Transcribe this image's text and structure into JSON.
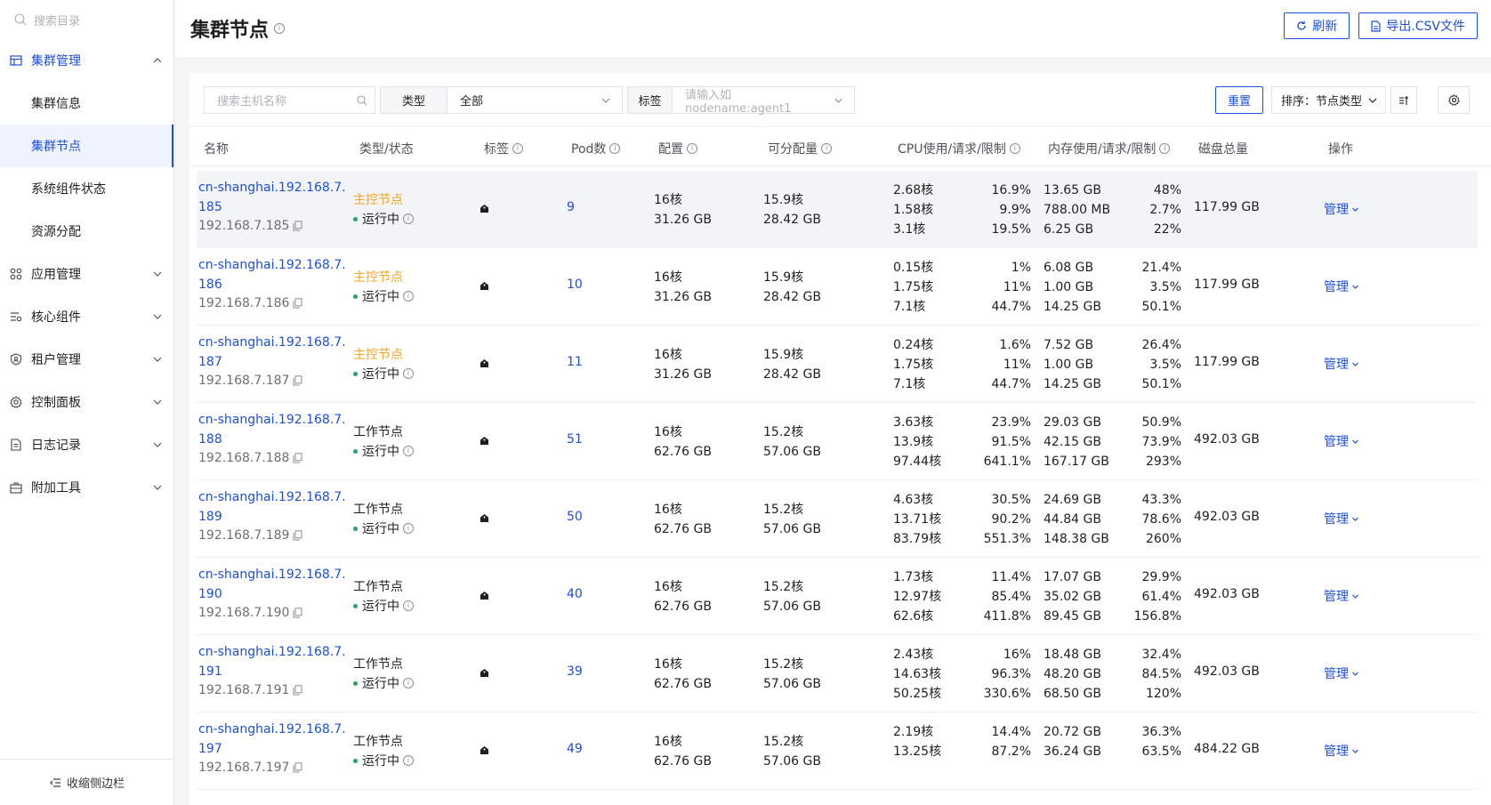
{
  "sidebar": {
    "search_placeholder": "搜索目录",
    "groups": [
      {
        "label": "集群管理",
        "icon": "cluster-icon",
        "expanded": true
      },
      {
        "label": "应用管理",
        "icon": "apps-icon"
      },
      {
        "label": "核心组件",
        "icon": "components-icon"
      },
      {
        "label": "租户管理",
        "icon": "tenant-icon"
      },
      {
        "label": "控制面板",
        "icon": "gear-icon"
      },
      {
        "label": "日志记录",
        "icon": "log-icon"
      },
      {
        "label": "附加工具",
        "icon": "toolbox-icon"
      }
    ],
    "sub_items": [
      "集群信息",
      "集群节点",
      "系统组件状态",
      "资源分配"
    ],
    "active_sub": "集群节点",
    "collapse_label": "收缩侧边栏"
  },
  "header": {
    "title": "集群节点",
    "refresh_label": "刷新",
    "export_label": "导出.CSV文件"
  },
  "filters": {
    "search_placeholder": "搜索主机名称",
    "type_label": "类型",
    "type_value": "全部",
    "tag_label": "标签",
    "tag_placeholder": "请输入如 nodename:agent1",
    "reset_label": "重置",
    "sort_label": "排序：节点类型"
  },
  "table": {
    "columns": [
      "名称",
      "类型/状态",
      "标签",
      "Pod数",
      "配置",
      "可分配量",
      "CPU使用/请求/限制",
      "内存使用/请求/限制",
      "磁盘总量",
      "操作"
    ],
    "rows": [
      {
        "name": "cn-shanghai.192.168.7.185",
        "ip": "192.168.7.185",
        "type": "主控节点",
        "status": "运行中",
        "pods": "9",
        "cfg_cpu": "16核",
        "cfg_mem": "31.26 GB",
        "alloc_cpu": "15.9核",
        "alloc_mem": "28.42 GB",
        "cpu": [
          [
            "2.68核",
            "16.9%"
          ],
          [
            "1.58核",
            "9.9%"
          ],
          [
            "3.1核",
            "19.5%"
          ]
        ],
        "mem": [
          [
            "13.65 GB",
            "48%"
          ],
          [
            "788.00 MB",
            "2.7%"
          ],
          [
            "6.25 GB",
            "22%"
          ]
        ],
        "disk": "117.99 GB",
        "op": "管理"
      },
      {
        "name": "cn-shanghai.192.168.7.186",
        "ip": "192.168.7.186",
        "type": "主控节点",
        "status": "运行中",
        "pods": "10",
        "cfg_cpu": "16核",
        "cfg_mem": "31.26 GB",
        "alloc_cpu": "15.9核",
        "alloc_mem": "28.42 GB",
        "cpu": [
          [
            "0.15核",
            "1%"
          ],
          [
            "1.75核",
            "11%"
          ],
          [
            "7.1核",
            "44.7%"
          ]
        ],
        "mem": [
          [
            "6.08 GB",
            "21.4%"
          ],
          [
            "1.00 GB",
            "3.5%"
          ],
          [
            "14.25 GB",
            "50.1%"
          ]
        ],
        "disk": "117.99 GB",
        "op": "管理"
      },
      {
        "name": "cn-shanghai.192.168.7.187",
        "ip": "192.168.7.187",
        "type": "主控节点",
        "status": "运行中",
        "pods": "11",
        "cfg_cpu": "16核",
        "cfg_mem": "31.26 GB",
        "alloc_cpu": "15.9核",
        "alloc_mem": "28.42 GB",
        "cpu": [
          [
            "0.24核",
            "1.6%"
          ],
          [
            "1.75核",
            "11%"
          ],
          [
            "7.1核",
            "44.7%"
          ]
        ],
        "mem": [
          [
            "7.52 GB",
            "26.4%"
          ],
          [
            "1.00 GB",
            "3.5%"
          ],
          [
            "14.25 GB",
            "50.1%"
          ]
        ],
        "disk": "117.99 GB",
        "op": "管理"
      },
      {
        "name": "cn-shanghai.192.168.7.188",
        "ip": "192.168.7.188",
        "type": "工作节点",
        "status": "运行中",
        "pods": "51",
        "cfg_cpu": "16核",
        "cfg_mem": "62.76 GB",
        "alloc_cpu": "15.2核",
        "alloc_mem": "57.06 GB",
        "cpu": [
          [
            "3.63核",
            "23.9%"
          ],
          [
            "13.9核",
            "91.5%"
          ],
          [
            "97.44核",
            "641.1%"
          ]
        ],
        "mem": [
          [
            "29.03 GB",
            "50.9%"
          ],
          [
            "42.15 GB",
            "73.9%"
          ],
          [
            "167.17 GB",
            "293%"
          ]
        ],
        "disk": "492.03 GB",
        "op": "管理"
      },
      {
        "name": "cn-shanghai.192.168.7.189",
        "ip": "192.168.7.189",
        "type": "工作节点",
        "status": "运行中",
        "pods": "50",
        "cfg_cpu": "16核",
        "cfg_mem": "62.76 GB",
        "alloc_cpu": "15.2核",
        "alloc_mem": "57.06 GB",
        "cpu": [
          [
            "4.63核",
            "30.5%"
          ],
          [
            "13.71核",
            "90.2%"
          ],
          [
            "83.79核",
            "551.3%"
          ]
        ],
        "mem": [
          [
            "24.69 GB",
            "43.3%"
          ],
          [
            "44.84 GB",
            "78.6%"
          ],
          [
            "148.38 GB",
            "260%"
          ]
        ],
        "disk": "492.03 GB",
        "op": "管理"
      },
      {
        "name": "cn-shanghai.192.168.7.190",
        "ip": "192.168.7.190",
        "type": "工作节点",
        "status": "运行中",
        "pods": "40",
        "cfg_cpu": "16核",
        "cfg_mem": "62.76 GB",
        "alloc_cpu": "15.2核",
        "alloc_mem": "57.06 GB",
        "cpu": [
          [
            "1.73核",
            "11.4%"
          ],
          [
            "12.97核",
            "85.4%"
          ],
          [
            "62.6核",
            "411.8%"
          ]
        ],
        "mem": [
          [
            "17.07 GB",
            "29.9%"
          ],
          [
            "35.02 GB",
            "61.4%"
          ],
          [
            "89.45 GB",
            "156.8%"
          ]
        ],
        "disk": "492.03 GB",
        "op": "管理"
      },
      {
        "name": "cn-shanghai.192.168.7.191",
        "ip": "192.168.7.191",
        "type": "工作节点",
        "status": "运行中",
        "pods": "39",
        "cfg_cpu": "16核",
        "cfg_mem": "62.76 GB",
        "alloc_cpu": "15.2核",
        "alloc_mem": "57.06 GB",
        "cpu": [
          [
            "2.43核",
            "16%"
          ],
          [
            "14.63核",
            "96.3%"
          ],
          [
            "50.25核",
            "330.6%"
          ]
        ],
        "mem": [
          [
            "18.48 GB",
            "32.4%"
          ],
          [
            "48.20 GB",
            "84.5%"
          ],
          [
            "68.50 GB",
            "120%"
          ]
        ],
        "disk": "492.03 GB",
        "op": "管理"
      },
      {
        "name": "cn-shanghai.192.168.7.197",
        "ip": "192.168.7.197",
        "type": "工作节点",
        "status": "运行中",
        "pods": "49",
        "cfg_cpu": "16核",
        "cfg_mem": "62.76 GB",
        "alloc_cpu": "15.2核",
        "alloc_mem": "57.06 GB",
        "cpu": [
          [
            "2.19核",
            "14.4%"
          ],
          [
            "13.25核",
            "87.2%"
          ],
          [
            "",
            ""
          ]
        ],
        "mem": [
          [
            "20.72 GB",
            "36.3%"
          ],
          [
            "36.24 GB",
            "63.5%"
          ],
          [
            "",
            ""
          ]
        ],
        "disk": "484.22 GB",
        "op": "管理"
      }
    ]
  },
  "colors": {
    "accent": "#1d4fd8",
    "master": "#f5a623",
    "running": "#1fa95c"
  }
}
